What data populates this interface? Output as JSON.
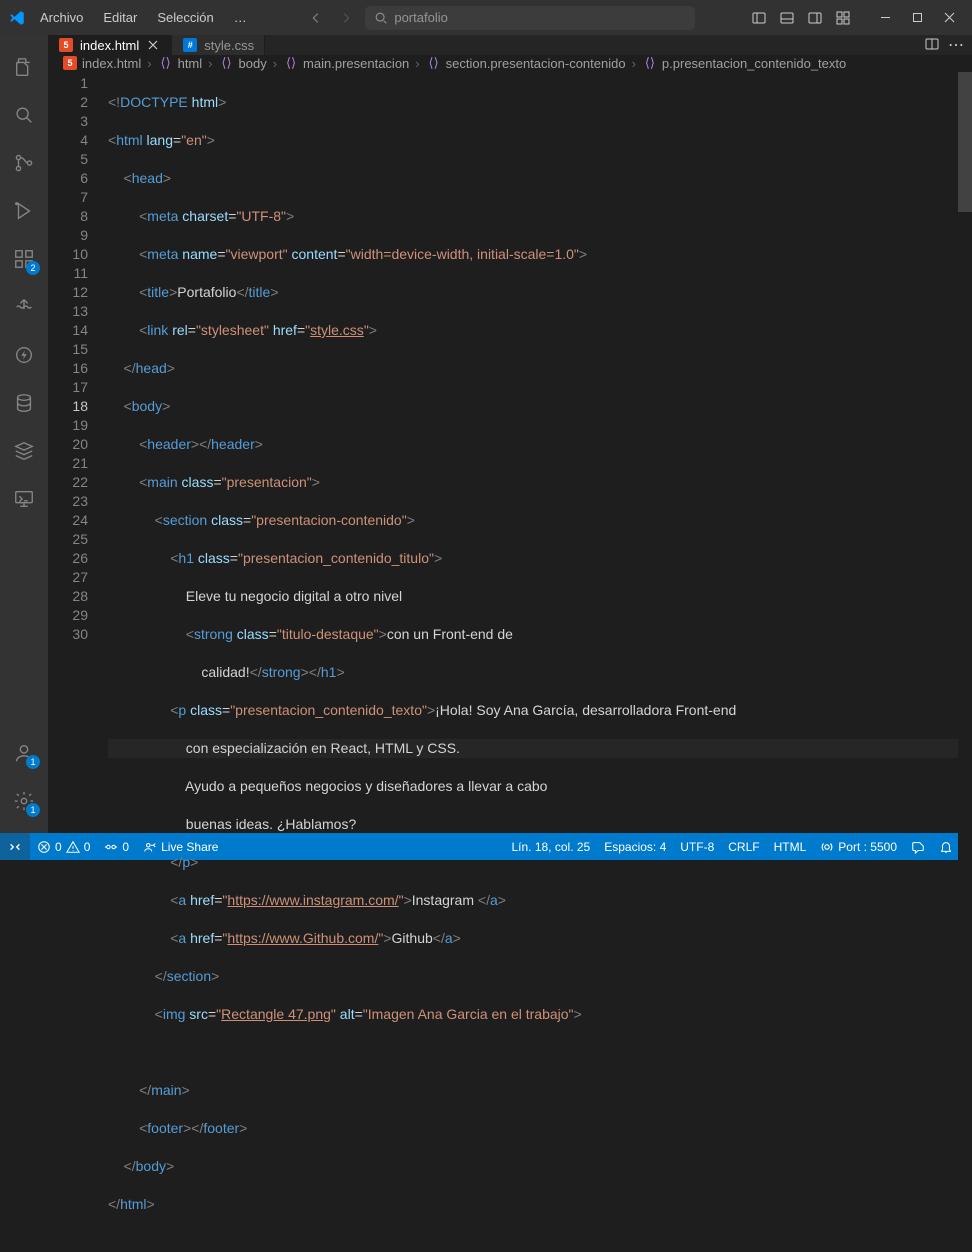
{
  "menu": {
    "archivo": "Archivo",
    "editar": "Editar",
    "seleccion": "Selección",
    "more": "…"
  },
  "search": {
    "text": "portafolio"
  },
  "tabs": {
    "t1": {
      "name": "index.html"
    },
    "t2": {
      "name": "style.css"
    }
  },
  "breadcrumbs": {
    "b1": "index.html",
    "b2": "html",
    "b3": "body",
    "b4": "main.presentacion",
    "b5": "section.presentacion-contenido",
    "b6": "p.presentacion_contenido_texto"
  },
  "lineNumbers": [
    "1",
    "2",
    "3",
    "4",
    "5",
    "6",
    "7",
    "8",
    "9",
    "10",
    "11",
    "12",
    "13",
    "14",
    "15",
    "16",
    "17",
    "18",
    "19",
    "20",
    "21",
    "22",
    "23",
    "24",
    "25",
    "26",
    "27",
    "28",
    "29",
    "30"
  ],
  "code": {
    "l1_a": "<!",
    "l1_b": "DOCTYPE",
    "l1_c": " html",
    "l1_d": ">",
    "l2a": "<",
    "l2b": "html",
    "l2c": " lang",
    "l2d": "=",
    "l2e": "\"en\"",
    "l2f": ">",
    "l3a": "    <",
    "l3b": "head",
    "l3c": ">",
    "l4a": "        <",
    "l4b": "meta",
    "l4c": " charset",
    "l4d": "=",
    "l4e": "\"UTF-8\"",
    "l4f": ">",
    "l5a": "        <",
    "l5b": "meta",
    "l5c": " name",
    "l5d": "=",
    "l5e": "\"viewport\"",
    "l5f": " content",
    "l5g": "=",
    "l5h": "\"width=device-width, initial-scale=1.0\"",
    "l5i": ">",
    "l6a": "        <",
    "l6b": "title",
    "l6c": ">",
    "l6d": "Portafolio",
    "l6e": "</",
    "l6f": "title",
    "l6g": ">",
    "l7a": "        <",
    "l7b": "link",
    "l7c": " rel",
    "l7d": "=",
    "l7e": "\"stylesheet\"",
    "l7f": " href",
    "l7g": "=",
    "l7h": "\"",
    "l7i": "style.css",
    "l7j": "\"",
    "l7k": ">",
    "l8a": "    </",
    "l8b": "head",
    "l8c": ">",
    "l9a": "    <",
    "l9b": "body",
    "l9c": ">",
    "l10a": "        <",
    "l10b": "header",
    "l10c": "></",
    "l10d": "header",
    "l10e": ">",
    "l11a": "        <",
    "l11b": "main",
    "l11c": " class",
    "l11d": "=",
    "l11e": "\"presentacion\"",
    "l11f": ">",
    "l12a": "            <",
    "l12b": "section",
    "l12c": " class",
    "l12d": "=",
    "l12e": "\"presentacion-contenido\"",
    "l12f": ">",
    "l13a": "                <",
    "l13b": "h1",
    "l13c": " class",
    "l13d": "=",
    "l13e": "\"presentacion_contenido_titulo\"",
    "l13f": ">",
    "l14a": "                    Eleve tu negocio digital a otro nivel",
    "l15a": "                    <",
    "l15b": "strong",
    "l15c": " class",
    "l15d": "=",
    "l15e": "\"titulo-destaque\"",
    "l15f": ">",
    "l15g": "con un Front-end de",
    "l16a": "                        calidad!",
    "l16b": "</",
    "l16c": "strong",
    "l16d": "></",
    "l16e": "h1",
    "l16f": ">",
    "l17a": "                <",
    "l17b": "p",
    "l17c": " class",
    "l17d": "=",
    "l17e": "\"presentacion_contenido_texto\"",
    "l17f": ">",
    "l17g": "¡Hola! Soy Ana García, desarrolladora Front-end",
    "l18a": "                    con especialización en React, HTML y CSS.",
    "l19a": "                    Ayudo a pequeños negocios y diseñadores a llevar a cabo",
    "l20a": "                    buenas ideas. ¿Hablamos?",
    "l21a": "                </",
    "l21b": "p",
    "l21c": ">",
    "l22a": "                <",
    "l22b": "a",
    "l22c": " href",
    "l22d": "=",
    "l22e": "\"",
    "l22f": "https://www.instagram.com/",
    "l22g": "\"",
    "l22h": ">",
    "l22i": "Instagram ",
    "l22j": "</",
    "l22k": "a",
    "l22l": ">",
    "l23a": "                <",
    "l23b": "a",
    "l23c": " href",
    "l23d": "=",
    "l23e": "\"",
    "l23f": "https://www.Github.com/",
    "l23g": "\"",
    "l23h": ">",
    "l23i": "Github",
    "l23j": "</",
    "l23k": "a",
    "l23l": ">",
    "l24a": "            </",
    "l24b": "section",
    "l24c": ">",
    "l25a": "            <",
    "l25b": "img",
    "l25c": " src",
    "l25d": "=",
    "l25e": "\"",
    "l25f": "Rectangle 47.png",
    "l25g": "\"",
    "l25h": " alt",
    "l25i": "=",
    "l25j": "\"Imagen Ana Garcia en el trabajo\"",
    "l25k": ">",
    "l26a": "",
    "l27a": "        </",
    "l27b": "main",
    "l27c": ">",
    "l28a": "        <",
    "l28b": "footer",
    "l28c": "></",
    "l28d": "footer",
    "l28e": ">",
    "l29a": "    </",
    "l29b": "body",
    "l29c": ">",
    "l30a": "</",
    "l30b": "html",
    "l30c": ">"
  },
  "status": {
    "errors": "0",
    "warnings": "0",
    "port_icon": "0",
    "liveshare": "Live Share",
    "pos": "Lín. 18, col. 25",
    "spaces": "Espacios: 4",
    "enc": "UTF-8",
    "eol": "CRLF",
    "lang": "HTML",
    "port": "Port : 5500"
  },
  "badges": {
    "accounts": "1",
    "settings": "1",
    "ext": "2"
  }
}
